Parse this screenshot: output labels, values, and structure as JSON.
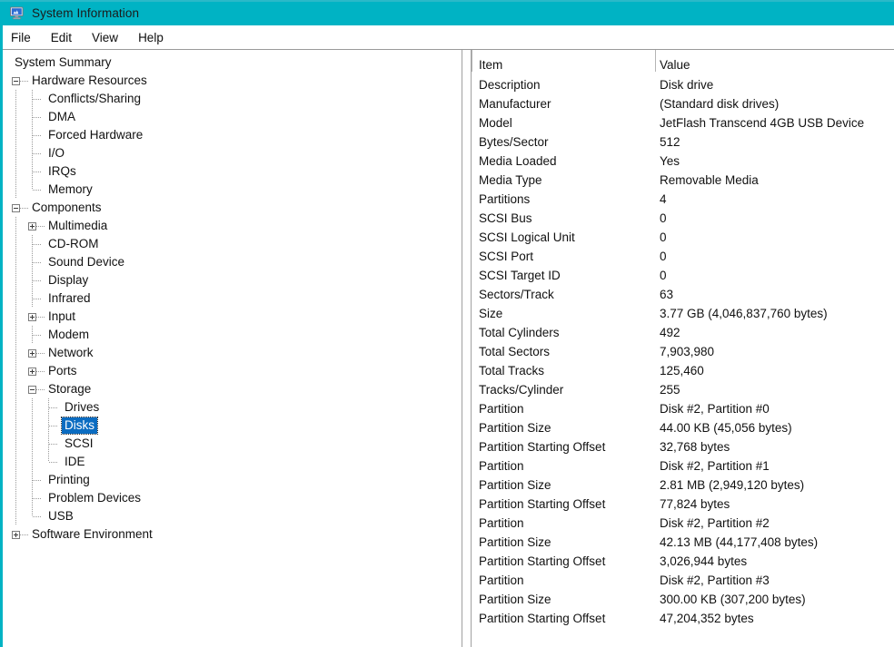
{
  "window": {
    "title": "System Information",
    "icon": "system-information-icon",
    "title_bar_color": "#00b3c4",
    "selection_color": "#0b6cc1"
  },
  "menu": {
    "items": [
      {
        "label": "File"
      },
      {
        "label": "Edit"
      },
      {
        "label": "View"
      },
      {
        "label": "Help"
      }
    ]
  },
  "tree": {
    "items": [
      {
        "label": "System Summary",
        "depth": 0,
        "expander": "none",
        "selected": false
      },
      {
        "label": "Hardware Resources",
        "depth": 0,
        "expander": "minus",
        "selected": false
      },
      {
        "label": "Conflicts/Sharing",
        "depth": 1,
        "expander": "leaf",
        "selected": false
      },
      {
        "label": "DMA",
        "depth": 1,
        "expander": "leaf",
        "selected": false
      },
      {
        "label": "Forced Hardware",
        "depth": 1,
        "expander": "leaf",
        "selected": false
      },
      {
        "label": "I/O",
        "depth": 1,
        "expander": "leaf",
        "selected": false
      },
      {
        "label": "IRQs",
        "depth": 1,
        "expander": "leaf",
        "selected": false
      },
      {
        "label": "Memory",
        "depth": 1,
        "expander": "leafend",
        "selected": false
      },
      {
        "label": "Components",
        "depth": 0,
        "expander": "minus",
        "selected": false
      },
      {
        "label": "Multimedia",
        "depth": 1,
        "expander": "plus",
        "selected": false
      },
      {
        "label": "CD-ROM",
        "depth": 1,
        "expander": "leaf",
        "selected": false
      },
      {
        "label": "Sound Device",
        "depth": 1,
        "expander": "leaf",
        "selected": false
      },
      {
        "label": "Display",
        "depth": 1,
        "expander": "leaf",
        "selected": false
      },
      {
        "label": "Infrared",
        "depth": 1,
        "expander": "leaf",
        "selected": false
      },
      {
        "label": "Input",
        "depth": 1,
        "expander": "plus",
        "selected": false
      },
      {
        "label": "Modem",
        "depth": 1,
        "expander": "leaf",
        "selected": false
      },
      {
        "label": "Network",
        "depth": 1,
        "expander": "plus",
        "selected": false
      },
      {
        "label": "Ports",
        "depth": 1,
        "expander": "plus",
        "selected": false
      },
      {
        "label": "Storage",
        "depth": 1,
        "expander": "minus",
        "selected": false
      },
      {
        "label": "Drives",
        "depth": 2,
        "expander": "leaf",
        "selected": false
      },
      {
        "label": "Disks",
        "depth": 2,
        "expander": "leaf",
        "selected": true
      },
      {
        "label": "SCSI",
        "depth": 2,
        "expander": "leaf",
        "selected": false
      },
      {
        "label": "IDE",
        "depth": 2,
        "expander": "leafend",
        "selected": false
      },
      {
        "label": "Printing",
        "depth": 1,
        "expander": "leaf",
        "selected": false
      },
      {
        "label": "Problem Devices",
        "depth": 1,
        "expander": "leaf",
        "selected": false
      },
      {
        "label": "USB",
        "depth": 1,
        "expander": "leafend",
        "selected": false
      },
      {
        "label": "Software Environment",
        "depth": 0,
        "expander": "plus",
        "selected": false
      }
    ]
  },
  "details": {
    "columns": [
      {
        "label": "Item"
      },
      {
        "label": "Value"
      }
    ],
    "rows": [
      {
        "item": "Description",
        "value": "Disk drive"
      },
      {
        "item": "Manufacturer",
        "value": "(Standard disk drives)"
      },
      {
        "item": "Model",
        "value": "JetFlash Transcend 4GB USB Device"
      },
      {
        "item": "Bytes/Sector",
        "value": "512"
      },
      {
        "item": "Media Loaded",
        "value": "Yes"
      },
      {
        "item": "Media Type",
        "value": "Removable Media"
      },
      {
        "item": "Partitions",
        "value": "4"
      },
      {
        "item": "SCSI Bus",
        "value": "0"
      },
      {
        "item": "SCSI Logical Unit",
        "value": "0"
      },
      {
        "item": "SCSI Port",
        "value": "0"
      },
      {
        "item": "SCSI Target ID",
        "value": "0"
      },
      {
        "item": "Sectors/Track",
        "value": "63"
      },
      {
        "item": "Size",
        "value": "3.77 GB (4,046,837,760 bytes)"
      },
      {
        "item": "Total Cylinders",
        "value": "492"
      },
      {
        "item": "Total Sectors",
        "value": "7,903,980"
      },
      {
        "item": "Total Tracks",
        "value": "125,460"
      },
      {
        "item": "Tracks/Cylinder",
        "value": "255"
      },
      {
        "item": "Partition",
        "value": "Disk #2, Partition #0"
      },
      {
        "item": "Partition Size",
        "value": "44.00 KB (45,056 bytes)"
      },
      {
        "item": "Partition Starting Offset",
        "value": "32,768 bytes"
      },
      {
        "item": "Partition",
        "value": "Disk #2, Partition #1"
      },
      {
        "item": "Partition Size",
        "value": "2.81 MB (2,949,120 bytes)"
      },
      {
        "item": "Partition Starting Offset",
        "value": "77,824 bytes"
      },
      {
        "item": "Partition",
        "value": "Disk #2, Partition #2"
      },
      {
        "item": "Partition Size",
        "value": "42.13 MB (44,177,408 bytes)"
      },
      {
        "item": "Partition Starting Offset",
        "value": "3,026,944 bytes"
      },
      {
        "item": "Partition",
        "value": "Disk #2, Partition #3"
      },
      {
        "item": "Partition Size",
        "value": "300.00 KB (307,200 bytes)"
      },
      {
        "item": "Partition Starting Offset",
        "value": "47,204,352 bytes"
      }
    ]
  }
}
